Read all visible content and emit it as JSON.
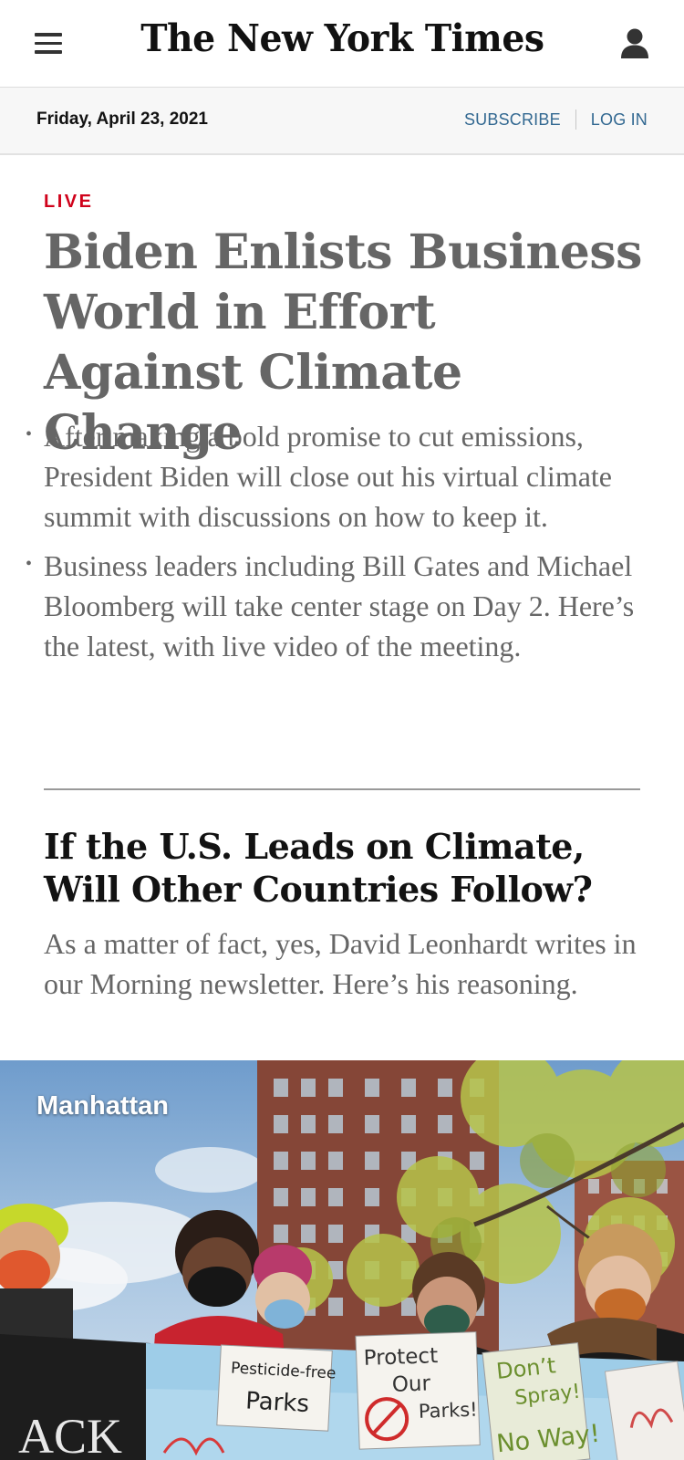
{
  "header": {
    "logo_text": "The New York Times",
    "menu_icon": "hamburger-menu-icon",
    "account_icon": "user-account-icon"
  },
  "datebar": {
    "date": "Friday, April 23, 2021",
    "subscribe_label": "SUBSCRIBE",
    "login_label": "LOG IN"
  },
  "lead_story": {
    "kicker": "LIVE",
    "headline": "Biden Enlists Business World in Effort Against Climate Change",
    "bullets": [
      "After making a bold promise to cut emissions, President Biden will close out his virtual climate summit with discussions on how to keep it.",
      "Business leaders including Bill Gates and Michael Bloomberg will take center stage on Day 2. Here’s the latest, with live video of the meeting."
    ]
  },
  "second_story": {
    "headline": "If the U.S. Leads on Climate, Will Other Countries Follow?",
    "summary": "As a matter of fact, yes, David Leonhardt writes in our Morning newsletter. Here’s his reasoning."
  },
  "photo": {
    "location_label": "Manhattan",
    "signs": {
      "sign1_line1": "Pesticide-free",
      "sign1_line2": "Parks",
      "sign2_line1": "Protect",
      "sign2_line2": "Our",
      "sign2_line3": "Parks!",
      "sign3_line1": "Don’t",
      "sign3_line2": "Spray!",
      "sign3_line3": "No Way!",
      "banner_text": "ACK"
    }
  },
  "colors": {
    "link_blue": "#326891",
    "live_red": "#d0021b",
    "headline_gray": "#666666"
  }
}
